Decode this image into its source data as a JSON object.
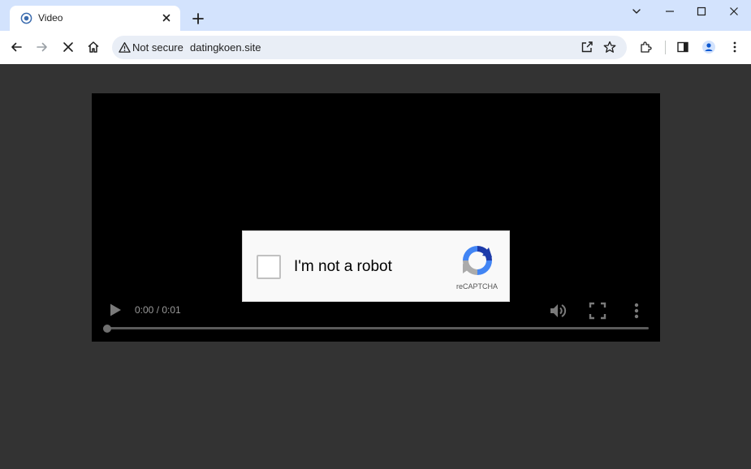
{
  "browser": {
    "tab": {
      "title": "Video",
      "close_label": "×"
    },
    "new_tab_label": "+",
    "address": {
      "security_label": "Not secure",
      "url": "datingkoen.site"
    }
  },
  "player": {
    "time": "0:00 / 0:01"
  },
  "captcha": {
    "checkbox_label": "I'm not a robot",
    "brand": "reCAPTCHA"
  },
  "colors": {
    "tabstrip": "#d3e3fd",
    "page_background": "#333333",
    "video_background": "#000000"
  },
  "icons": [
    "favicon-icon",
    "close-icon",
    "plus-icon",
    "chevron-down-icon",
    "minimize-icon",
    "maximize-icon",
    "window-close-icon",
    "back-arrow-icon",
    "forward-arrow-icon",
    "stop-icon",
    "home-icon",
    "warning-icon",
    "share-icon",
    "star-icon",
    "extensions-icon",
    "side-panel-icon",
    "profile-icon",
    "menu-kebab-icon",
    "play-icon",
    "volume-icon",
    "fullscreen-icon",
    "more-options-icon",
    "recaptcha-logo-icon"
  ]
}
